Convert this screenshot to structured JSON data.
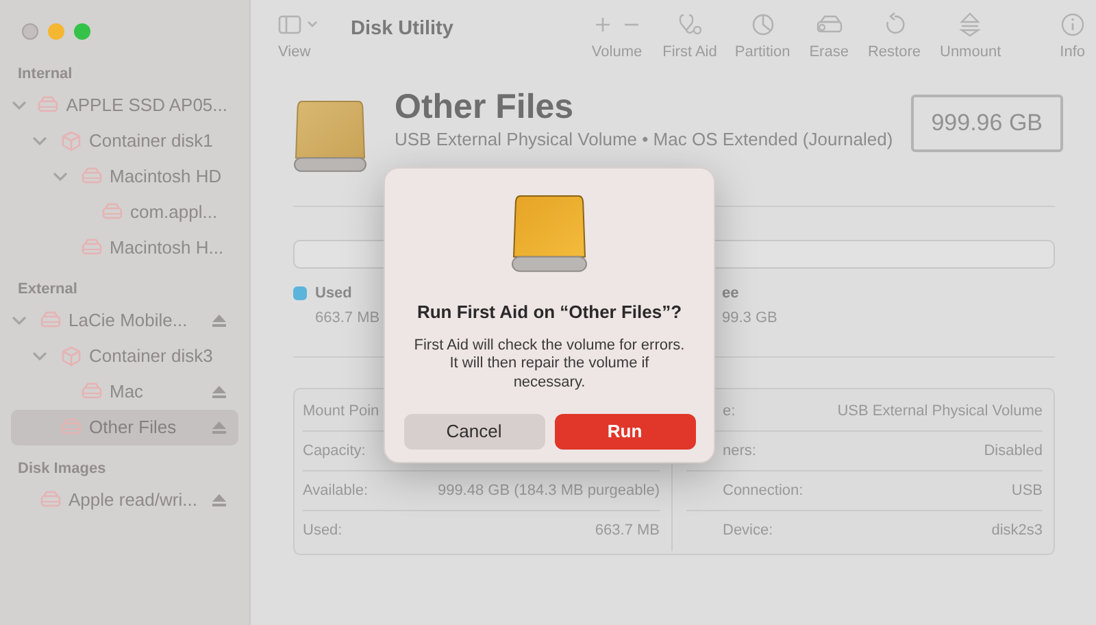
{
  "toolbar": {
    "view_label": "View",
    "title": "Disk Utility",
    "buttons": [
      {
        "kind": "volume",
        "label": "Volume"
      },
      {
        "kind": "first_aid",
        "label": "First Aid"
      },
      {
        "kind": "partition",
        "label": "Partition"
      },
      {
        "kind": "erase",
        "label": "Erase"
      },
      {
        "kind": "restore",
        "label": "Restore"
      },
      {
        "kind": "unmount",
        "label": "Unmount"
      },
      {
        "kind": "info",
        "label": "Info"
      }
    ]
  },
  "sidebar": {
    "sections": [
      {
        "header": "Internal",
        "items": [
          {
            "label": "APPLE SSD AP05...",
            "kind": "disk",
            "selected": false,
            "eject": false,
            "expanded": true,
            "children": [
              {
                "label": "Container disk1",
                "kind": "container",
                "selected": false,
                "eject": false,
                "expanded": true,
                "children": [
                  {
                    "label": "Macintosh HD",
                    "kind": "disk",
                    "selected": false,
                    "eject": false,
                    "expanded": true,
                    "children": [
                      {
                        "label": "com.appl...",
                        "kind": "disk",
                        "selected": false,
                        "eject": false
                      }
                    ]
                  },
                  {
                    "label": "Macintosh H...",
                    "kind": "disk",
                    "selected": false,
                    "eject": false
                  }
                ]
              }
            ]
          }
        ]
      },
      {
        "header": "External",
        "items": [
          {
            "label": "LaCie Mobile...",
            "kind": "disk",
            "selected": false,
            "eject": true,
            "expanded": true,
            "children": [
              {
                "label": "Container disk3",
                "kind": "container",
                "selected": false,
                "eject": false,
                "expanded": true,
                "children": [
                  {
                    "label": "Mac",
                    "kind": "disk",
                    "selected": false,
                    "eject": true
                  }
                ]
              },
              {
                "label": "Other Files",
                "kind": "disk",
                "selected": true,
                "eject": true
              }
            ]
          }
        ]
      },
      {
        "header": "Disk Images",
        "items": [
          {
            "label": "Apple read/wri...",
            "kind": "disk",
            "selected": false,
            "eject": true
          }
        ]
      }
    ]
  },
  "volume": {
    "name": "Other Files",
    "subtitle": "USB External Physical Volume • Mac OS Extended (Journaled)",
    "size": "999.96 GB"
  },
  "usage": {
    "legend": [
      {
        "label": "Used",
        "value": "663.7 MB",
        "color": "#5ab4dc"
      },
      {
        "label": "ee",
        "value": "99.3 GB"
      }
    ]
  },
  "info": {
    "left": [
      {
        "label": "Mount Poin"
      },
      {
        "label": "Capacity:"
      },
      {
        "label": "Available:",
        "value": "999.48 GB (184.3 MB purgeable)"
      },
      {
        "label": "Used:",
        "value": "663.7 MB"
      }
    ],
    "right": [
      {
        "label": "e:",
        "value": "USB External Physical Volume"
      },
      {
        "label": "ners:",
        "value": "Disabled"
      },
      {
        "label": "Connection:",
        "value": "USB"
      },
      {
        "label": "Device:",
        "value": "disk2s3"
      }
    ]
  },
  "dialog": {
    "title": "Run First Aid on “Other Files”?",
    "message": "First Aid will check the volume for errors. It will then repair the volume if necessary.",
    "buttons": [
      {
        "label": "Cancel",
        "kind": "cancel"
      },
      {
        "label": "Run",
        "kind": "default"
      }
    ]
  }
}
